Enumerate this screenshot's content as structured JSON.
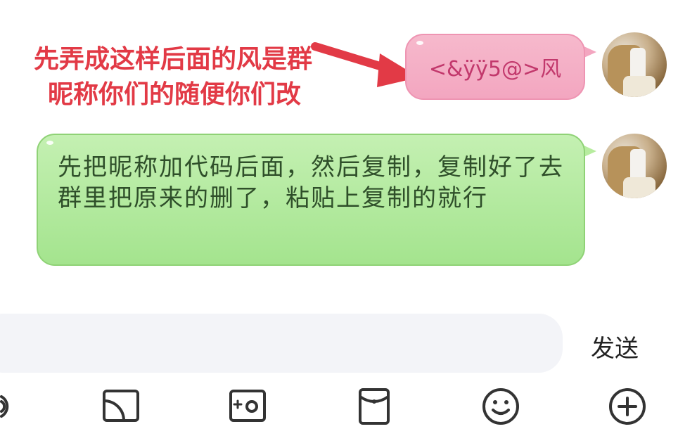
{
  "annotation": {
    "line1": "先弄成这样后面的风是群",
    "line2": "昵称你们的随便你们改"
  },
  "messages": [
    {
      "text": "<&ÿÿ5@>风",
      "style": "pink"
    },
    {
      "text": "先把昵称加代码后面，然后复制，复制好了去群里把原来的删了，粘贴上复制的就行",
      "style": "green"
    }
  ],
  "input": {
    "placeholder": "",
    "value": ""
  },
  "send_label": "发送",
  "toolbar_icons": [
    "voice-icon",
    "screen-cast-icon",
    "photo-icon",
    "red-packet-icon",
    "emoji-icon",
    "plus-icon"
  ],
  "colors": {
    "annotation": "#e23a46",
    "pink_bubble": "#f3a6c0",
    "green_bubble": "#b7ec9f"
  }
}
